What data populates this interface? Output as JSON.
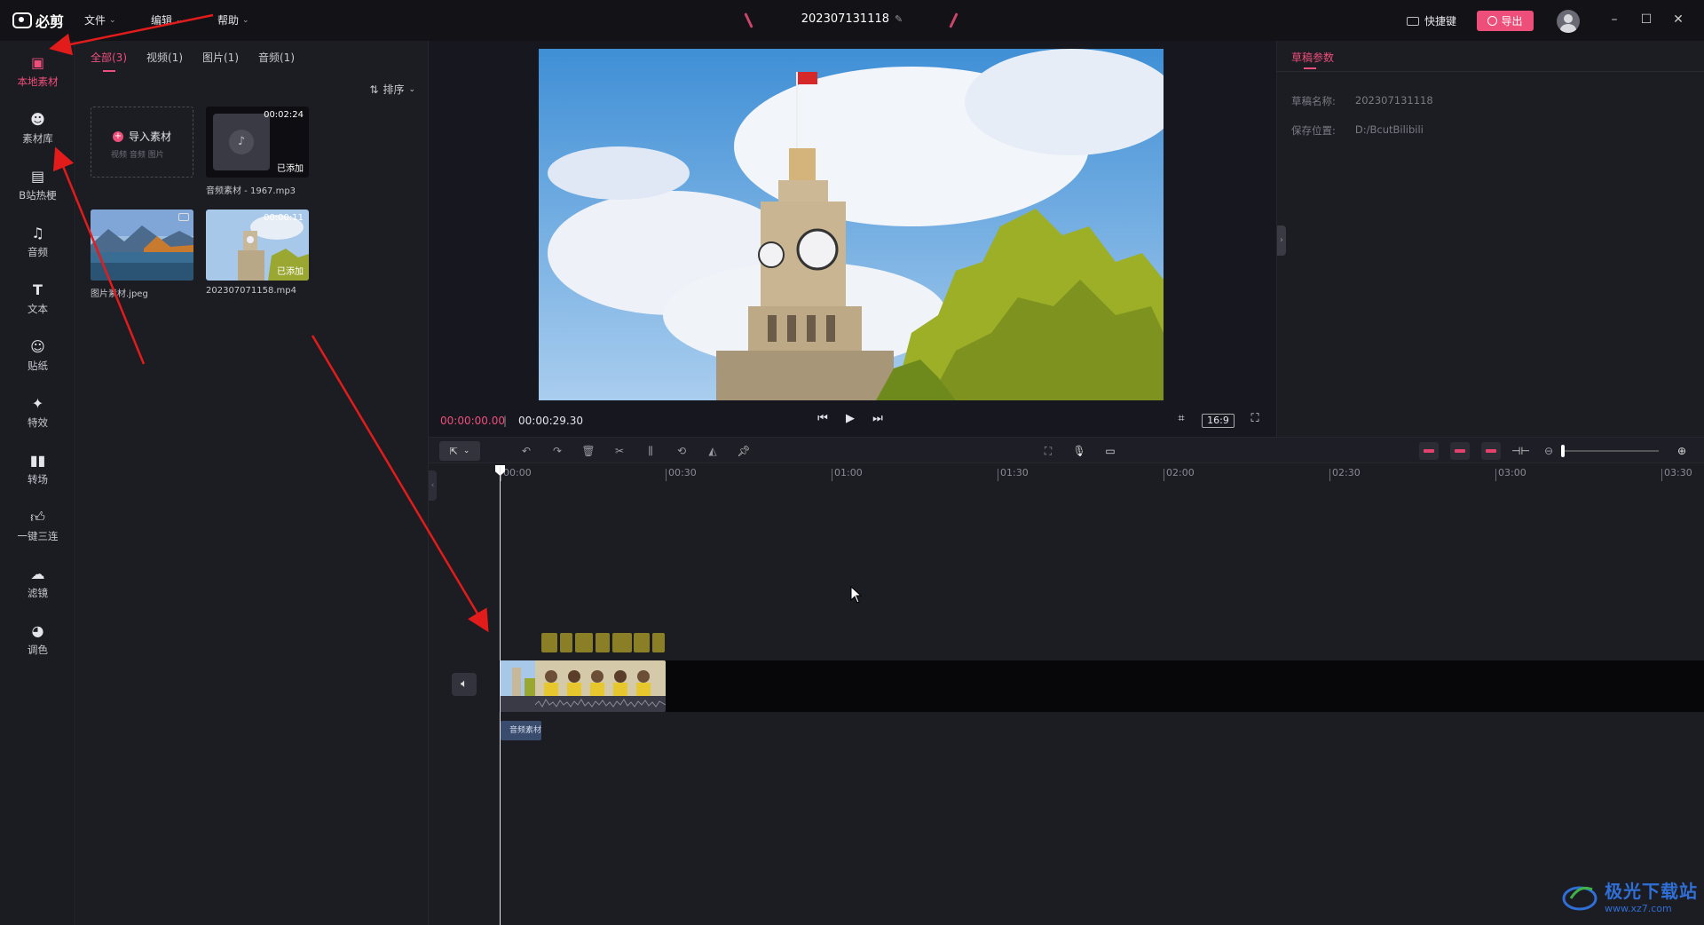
{
  "app": {
    "name": "必剪"
  },
  "menu": [
    {
      "label": "文件"
    },
    {
      "label": "编辑"
    },
    {
      "label": "帮助"
    }
  ],
  "project": {
    "title": "202307131118"
  },
  "topbar": {
    "shortcut_label": "快捷键",
    "export_label": "导出"
  },
  "rail": [
    {
      "label": "本地素材",
      "icon": "folder-icon"
    },
    {
      "label": "素材库",
      "icon": "library-icon"
    },
    {
      "label": "B站热梗",
      "icon": "bilibili-icon"
    },
    {
      "label": "音频",
      "icon": "music-note-icon"
    },
    {
      "label": "文本",
      "icon": "text-icon"
    },
    {
      "label": "贴纸",
      "icon": "sticker-icon"
    },
    {
      "label": "特效",
      "icon": "effect-icon"
    },
    {
      "label": "转场",
      "icon": "transition-icon"
    },
    {
      "label": "一键三连",
      "icon": "thumbs-up-icon"
    },
    {
      "label": "滤镜",
      "icon": "filter-icon"
    },
    {
      "label": "调色",
      "icon": "palette-icon"
    }
  ],
  "materials": {
    "tabs": [
      {
        "label": "全部(3)",
        "active": true
      },
      {
        "label": "视频(1)"
      },
      {
        "label": "图片(1)"
      },
      {
        "label": "音频(1)"
      }
    ],
    "sort_label": "排序",
    "import": {
      "label": "导入素材",
      "sub": "视频  音频  图片"
    },
    "items": [
      {
        "name": "音频素材 - 1967.mp3",
        "duration": "00:02:24",
        "added": "已添加",
        "type": "audio"
      },
      {
        "name": "图片素材.jpeg",
        "type": "image"
      },
      {
        "name": "202307071158.mp4",
        "duration": "00:00:11",
        "added": "已添加",
        "type": "video"
      }
    ]
  },
  "preview": {
    "current_time": "00:00:00.00",
    "separator": "|",
    "total_time": "00:00:29.30",
    "ratio": "16:9"
  },
  "props": {
    "title": "草稿参数",
    "rows": [
      {
        "key": "草稿名称:",
        "value": "202307131118"
      },
      {
        "key": "保存位置:",
        "value": "D:/BcutBilibili"
      }
    ]
  },
  "timeline": {
    "ticks": [
      "00:00",
      "00:30",
      "01:00",
      "01:30",
      "02:00",
      "02:30",
      "03:00",
      "03:30"
    ],
    "audio_clip_label": "音频素材"
  },
  "watermark": {
    "text": "极光下载站",
    "url": "www.xz7.com"
  },
  "colors": {
    "accent": "#ee4f7a",
    "background": "#17171f",
    "panel": "#1c1c23"
  }
}
